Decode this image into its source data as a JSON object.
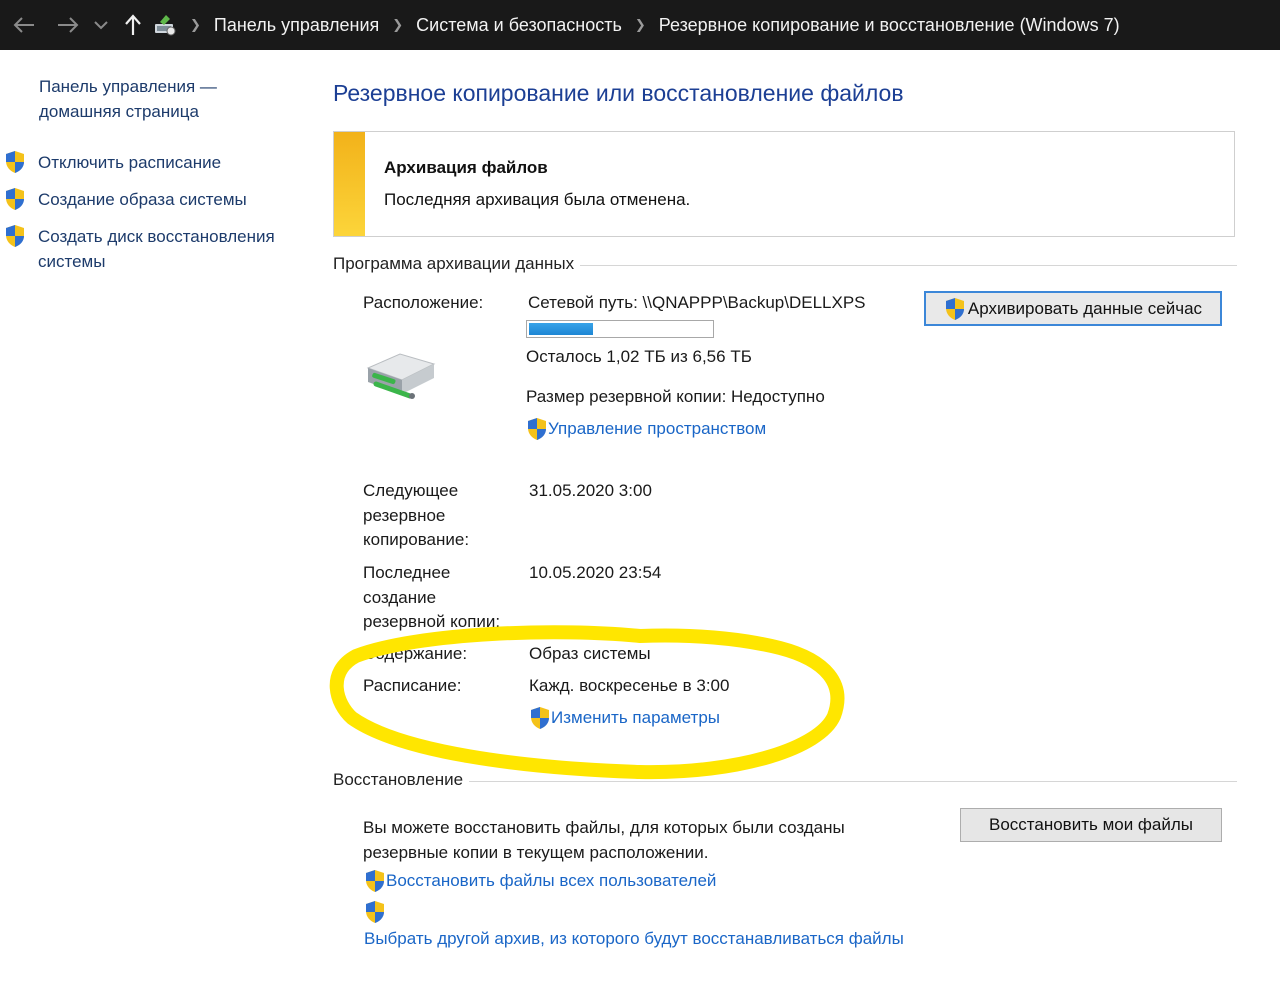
{
  "titlebar": {
    "breadcrumb": [
      "Панель управления",
      "Система и безопасность",
      "Резервное копирование и восстановление (Windows 7)"
    ]
  },
  "sidebar": {
    "home_link": "Панель управления — домашняя страница",
    "items": [
      {
        "label": "Отключить расписание",
        "icon": "uac-shield-icon"
      },
      {
        "label": "Создание образа системы",
        "icon": "uac-shield-icon"
      },
      {
        "label": "Создать диск восстановления системы",
        "icon": "uac-shield-icon"
      }
    ]
  },
  "main": {
    "title": "Резервное копирование или восстановление файлов",
    "alert": {
      "title": "Архивация файлов",
      "text": "Последняя архивация была отменена.",
      "accent_color": "#f2b21a"
    },
    "backup": {
      "section_title": "Программа архивации данных",
      "location_label": "Расположение:",
      "location_value": "Сетевой путь: \\\\QNAPPP\\Backup\\DELLXPS",
      "disk_used_fraction": 0.35,
      "free_space": "Осталось 1,02 ТБ из 6,56 ТБ",
      "backup_size": "Размер резервной копии: Недоступно",
      "manage_space_link": "Управление пространством",
      "backup_now_button": "Архивировать данные сейчас",
      "next_backup_label": "Следующее резервное копирование:",
      "next_backup_value": "31.05.2020 3:00",
      "last_backup_label": "Последнее создание резервной копии:",
      "last_backup_value": "10.05.2020 23:54",
      "contents_label": "Содержание:",
      "contents_value": "Образ системы",
      "schedule_label": "Расписание:",
      "schedule_value": "Кажд. воскресенье в 3:00",
      "change_settings_link": "Изменить параметры"
    },
    "restore": {
      "section_title": "Восстановление",
      "description": "Вы можете восстановить файлы, для которых были созданы резервные копии в текущем расположении.",
      "restore_my_files_button": "Восстановить мои файлы",
      "restore_all_users_link": "Восстановить файлы всех пользователей",
      "select_other_backup_link": "Выбрать другой архив, из которого будут восстанавливаться файлы"
    }
  },
  "colors": {
    "link": "#1a66c7",
    "annotation": "#ffe600"
  }
}
